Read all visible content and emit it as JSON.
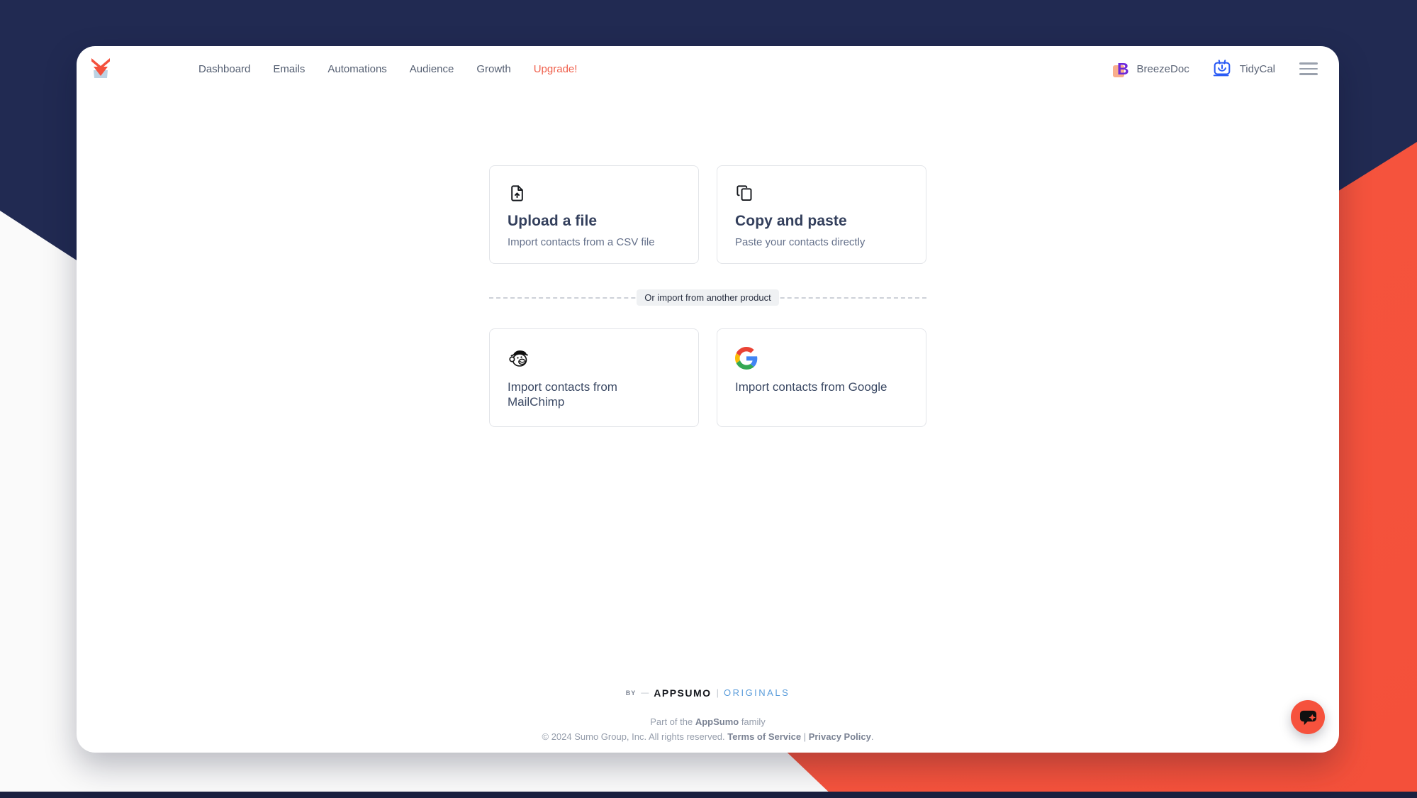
{
  "colors": {
    "navy_bg": "#212A52",
    "orange_bg": "#F4503A",
    "bottom_strip": "#1A2040",
    "upgrade_text": "#F0604C",
    "title_text": "#333F5C",
    "subtitle_text": "#64708A",
    "nav_text": "#545E71",
    "originals_blue": "#5B9DDB",
    "chat_fab": "#F6523D"
  },
  "nav": {
    "logo_name": "sendfox-fox-logo",
    "items": [
      {
        "label": "Dashboard"
      },
      {
        "label": "Emails"
      },
      {
        "label": "Automations"
      },
      {
        "label": "Audience"
      },
      {
        "label": "Growth"
      },
      {
        "label": "Upgrade!"
      }
    ]
  },
  "header_right": {
    "breezedoc_label": "BreezeDoc",
    "tidycal_label": "TidyCal",
    "menu_icon": "hamburger-menu"
  },
  "import": {
    "cards": [
      {
        "icon": "file-upload-icon",
        "title": "Upload a file",
        "subtitle": "Import contacts from a CSV file"
      },
      {
        "icon": "copy-icon",
        "title": "Copy and paste",
        "subtitle": "Paste your contacts directly"
      }
    ],
    "divider_label": "Or import from another product",
    "product_cards": [
      {
        "icon": "mailchimp-logo",
        "label": "Import contacts from MailChimp"
      },
      {
        "icon": "google-logo",
        "label": "Import contacts from Google"
      }
    ]
  },
  "footer": {
    "by": "BY",
    "dash": "—",
    "appsumo_wordmark": "APPSUMO",
    "separator": "|",
    "originals": "ORIGINALS",
    "family_prefix": "Part of the ",
    "family_bold": "AppSumo",
    "family_suffix": " family",
    "copyright_prefix": "© 2024 Sumo Group, Inc. All rights reserved. ",
    "terms_link": "Terms of Service",
    "link_separator": " | ",
    "privacy_link": "Privacy Policy",
    "copyright_end": "."
  },
  "chat": {
    "launcher_name": "chat-widget-launcher"
  }
}
